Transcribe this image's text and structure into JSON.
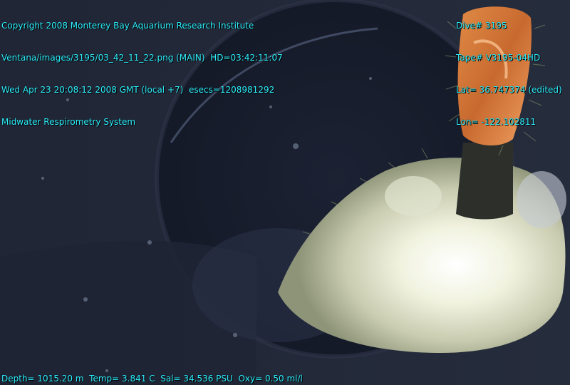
{
  "overlay": {
    "top_left": [
      "Copyright 2008 Monterey Bay Aquarium Research Institute",
      "Ventana/images/3195/03_42_11_22.png (MAIN)  HD=03:42:11:07",
      "Wed Apr 23 20:08:12 2008 GMT (local +7)  esecs=1208981292",
      "Midwater Respirometry System"
    ],
    "top_right": [
      "Dive# 3195",
      "Tape# V3195-04HD",
      "Lat= 36.747374 (edited)",
      "Lon= -122.102811"
    ],
    "bottom": "Depth= 1015.20 m  Temp= 3.841 C  Sal= 34.536 PSU  Oxy= 0.50 ml/l"
  },
  "colors": {
    "overlay_text": "#2ef0ff",
    "water": "#1c2233",
    "chamber_light": "#f4f6e8",
    "orange_object": "#d97a3a"
  }
}
